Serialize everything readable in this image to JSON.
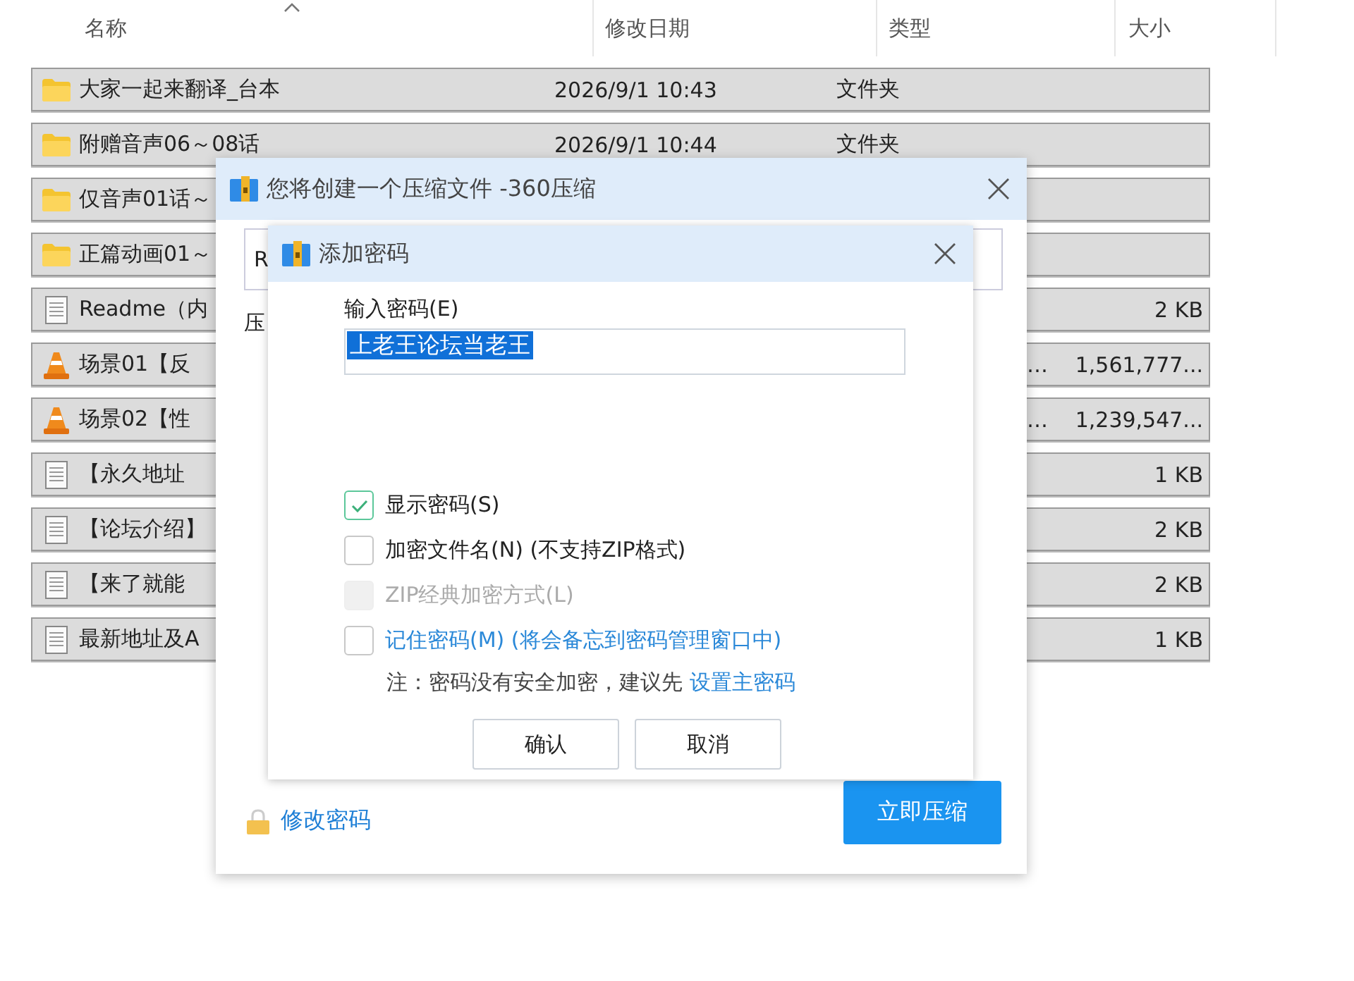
{
  "explorer": {
    "columns": [
      {
        "label": "名称",
        "sorted": true
      },
      {
        "label": "修改日期",
        "sorted": false
      },
      {
        "label": "类型",
        "sorted": false
      },
      {
        "label": "大小",
        "sorted": false
      }
    ],
    "rows": [
      {
        "kind": "folder",
        "name": "大家一起来翻译_台本",
        "date": "2026/9/1 10:43",
        "type": "文件夹"
      },
      {
        "kind": "folder",
        "name": "附赠音声06～08话",
        "date": "2026/9/1 10:44",
        "type": "文件夹"
      },
      {
        "kind": "folder",
        "name": "仅音声01话～"
      },
      {
        "kind": "folder",
        "name": "正篇动画01～"
      },
      {
        "kind": "document",
        "name": "Readme（内",
        "size": "2 KB"
      },
      {
        "kind": "video",
        "name": "场景01【反",
        "type_tail": "…",
        "size": "1,561,777..."
      },
      {
        "kind": "video",
        "name": "场景02【性",
        "type_tail": "…",
        "size": "1,239,547..."
      },
      {
        "kind": "document",
        "name": "【永久地址",
        "size": "1 KB"
      },
      {
        "kind": "document",
        "name": "【论坛介绍】",
        "size": "2 KB"
      },
      {
        "kind": "document",
        "name": "【来了就能",
        "size": "2 KB"
      },
      {
        "kind": "document",
        "name": "最新地址及A",
        "size": "1 KB"
      }
    ]
  },
  "compress_dialog": {
    "title": "您将创建一个压缩文件 -360压缩",
    "field_value": "R",
    "label": "压",
    "change_password_link": "修改密码",
    "compress_button": "立即压缩"
  },
  "password_dialog": {
    "title": "添加密码",
    "field_label": "输入密码(E)",
    "password": "上老王论坛当老王",
    "options": [
      {
        "kind": "plain",
        "label": "显示密码(S)",
        "checked": true,
        "disabled": false
      },
      {
        "kind": "plain",
        "label": "加密文件名(N) (不支持ZIP格式)",
        "checked": false,
        "disabled": false
      },
      {
        "kind": "plain",
        "label": "ZIP经典加密方式(L)",
        "checked": false,
        "disabled": true
      },
      {
        "kind": "link",
        "label": "记住密码(M) (将会备忘到密码管理窗口中)",
        "checked": false,
        "disabled": false
      }
    ],
    "note": "注：密码没有安全加密，建议先 ",
    "note_link": "设置主密码",
    "buttons": [
      "确认",
      "取消"
    ]
  }
}
